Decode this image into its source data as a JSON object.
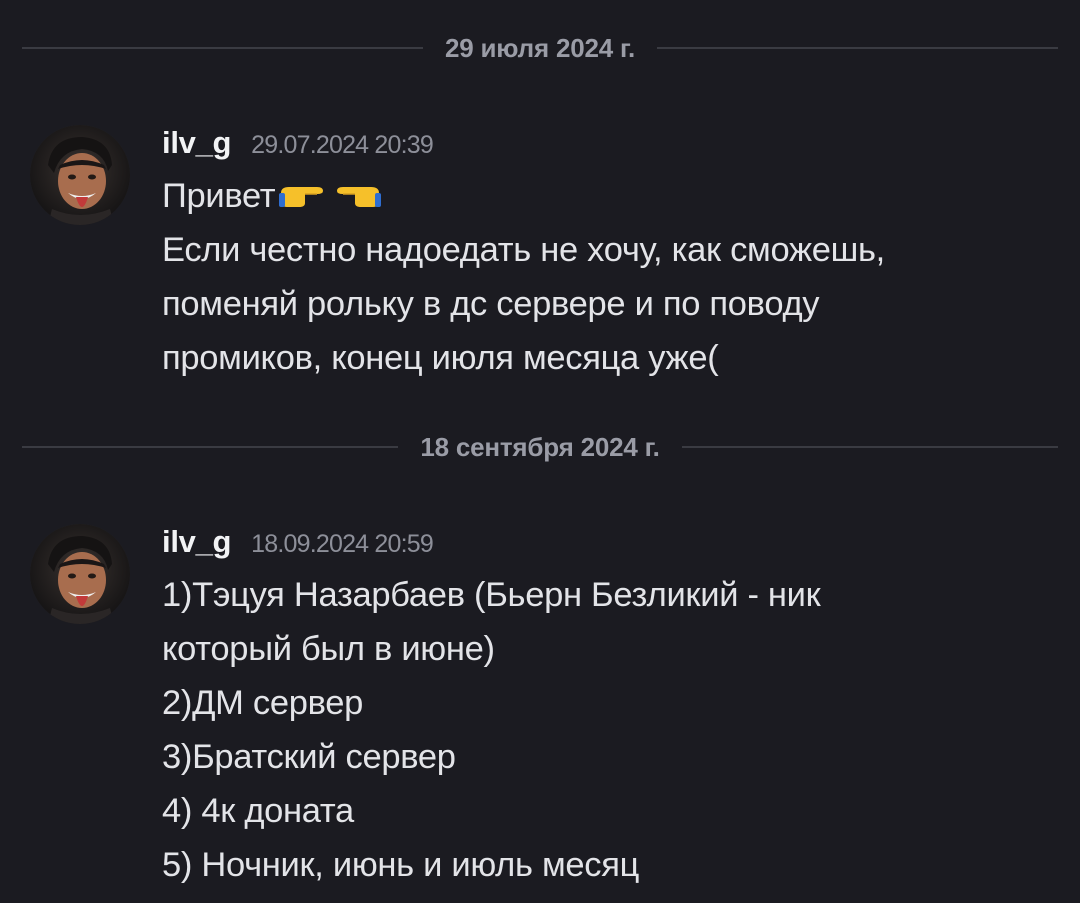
{
  "dividers": [
    {
      "label": "29 июля 2024 г."
    },
    {
      "label": "18 сентября 2024 г."
    }
  ],
  "messages": [
    {
      "username": "ilv_g",
      "timestamp": "29.07.2024 20:39",
      "avatar_icon": "user-avatar",
      "lines": [
        "Привет",
        "Если честно надоедать не хочу, как сможешь,",
        "поменяй рольку в дс сервере и по поводу",
        "промиков, конец июля месяца уже("
      ],
      "emojis": [
        "backhand-index-pointing-right-icon",
        "backhand-index-pointing-left-icon"
      ]
    },
    {
      "username": "ilv_g",
      "timestamp": "18.09.2024 20:59",
      "avatar_icon": "user-avatar",
      "lines": [
        "1)Тэцуя Назарбаев (Бьерн Безликий - ник",
        "который был в июне)",
        "2)ДМ сервер",
        "3)Братский сервер",
        "4) 4к доната",
        "5) Ночник, июнь и июль месяц"
      ]
    }
  ],
  "colors": {
    "background": "#1b1b21",
    "username": "#f2f3f5",
    "text": "#e3e4e8",
    "muted": "#8d8f99",
    "divider": "#3a3b42"
  }
}
